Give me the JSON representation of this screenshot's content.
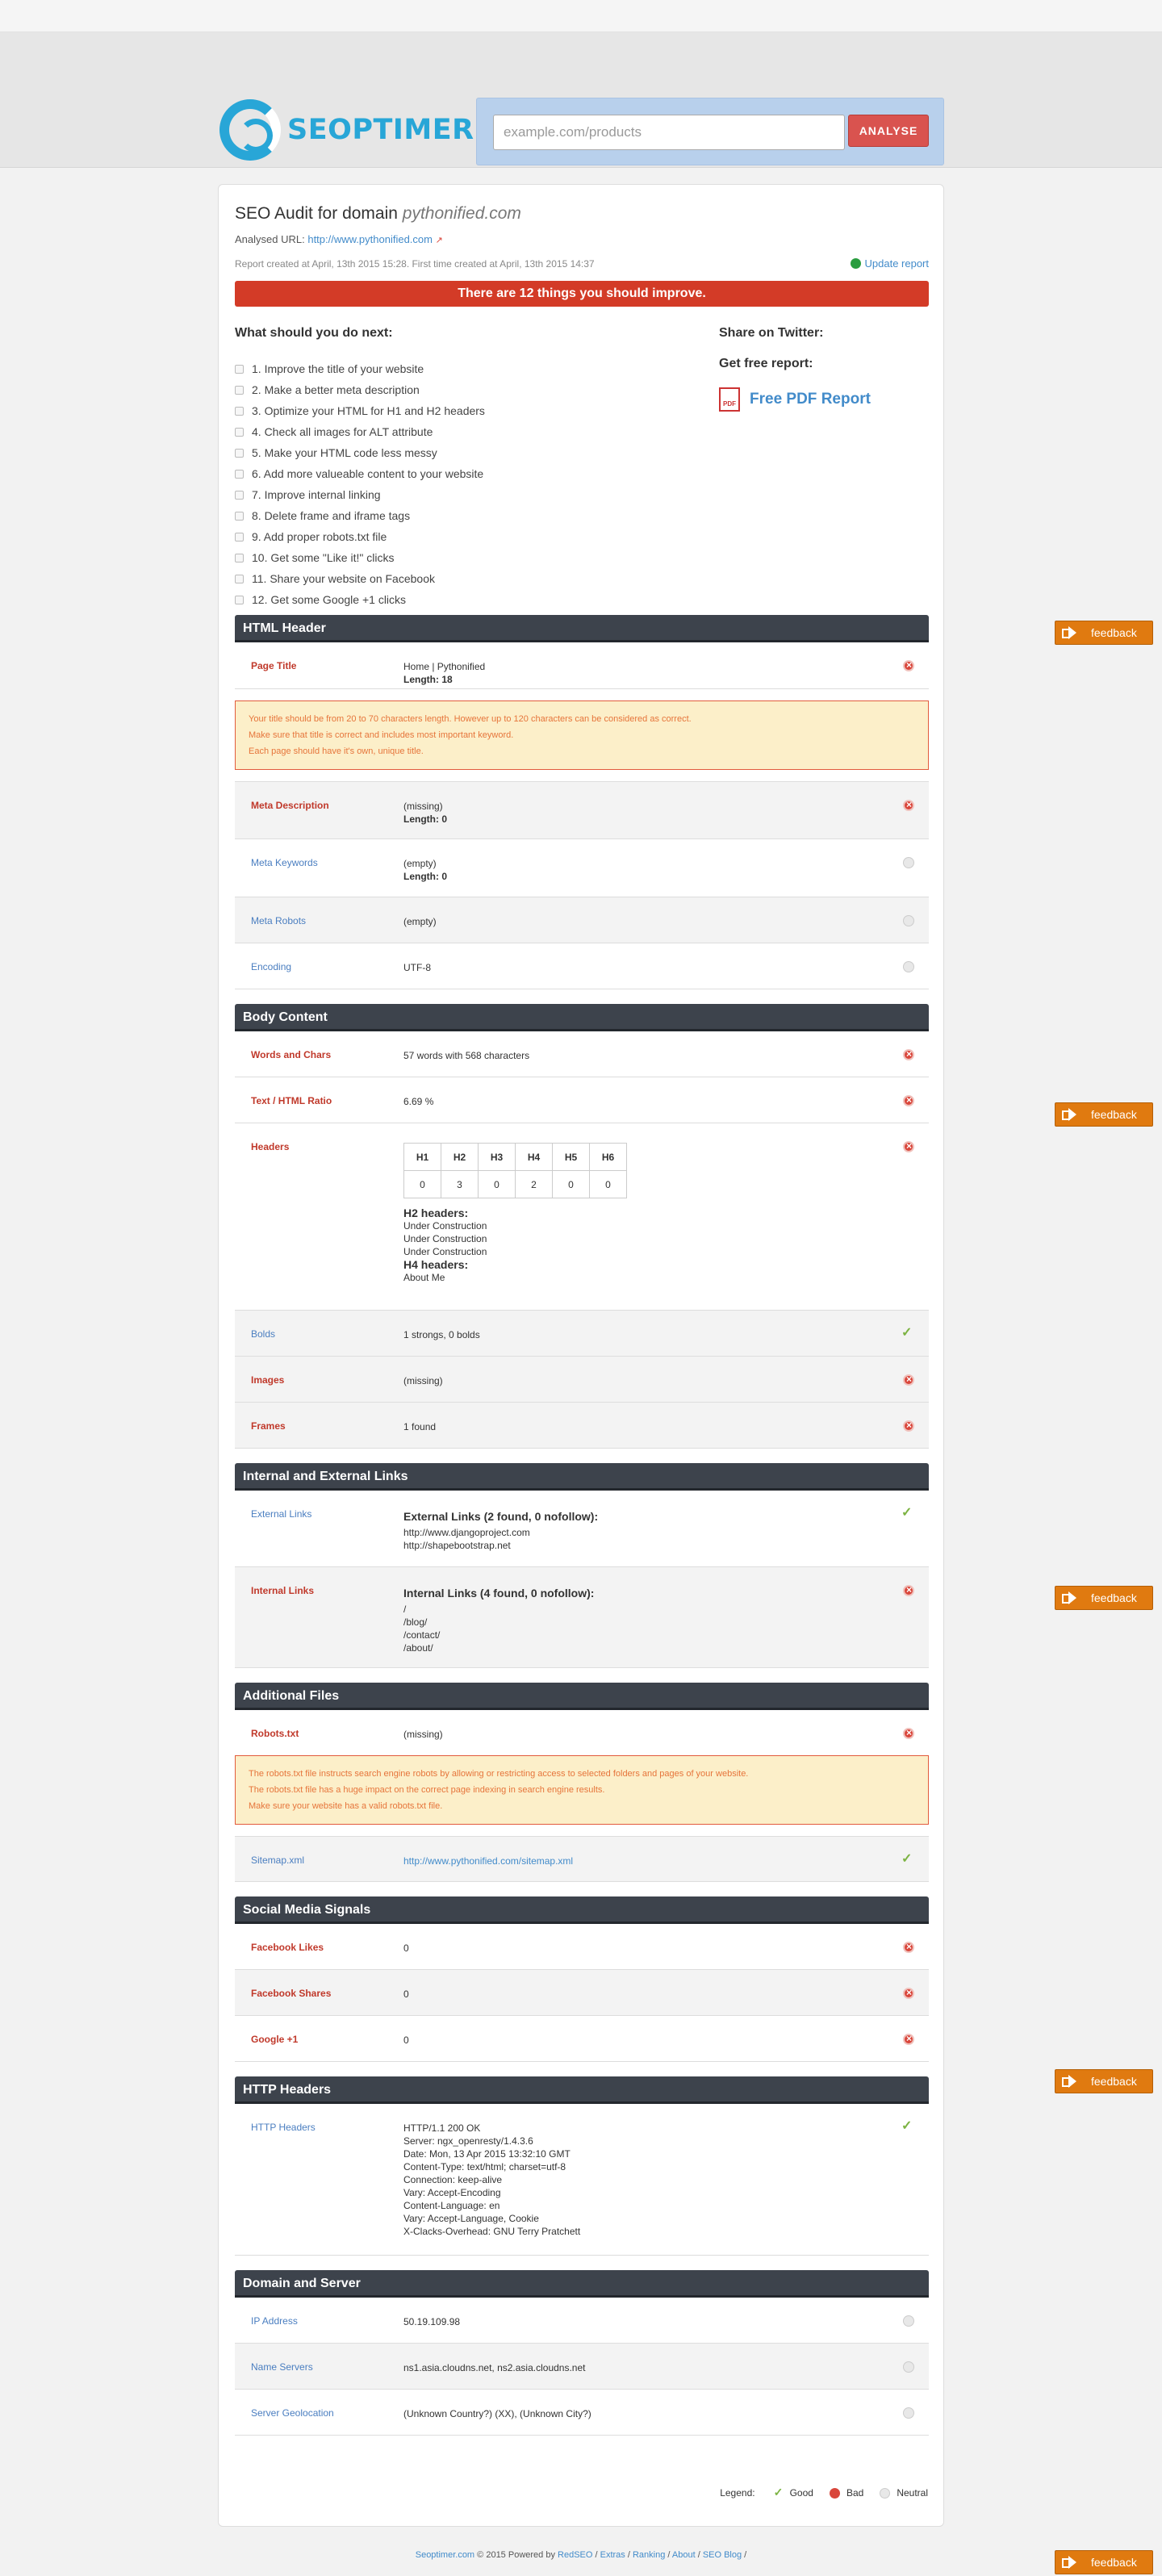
{
  "header": {
    "logo_text": "SEOPTIMER",
    "search_placeholder": "example.com/products",
    "analyse_label": "ANALYSE"
  },
  "report": {
    "title_prefix": "SEO Audit for domain",
    "domain": "pythonified.com",
    "analysed_label": "Analysed URL:",
    "analysed_url": "http://www.pythonified.com",
    "created_text": "Report created at April, 13th 2015 15:28. First time created at April, 13th 2015 14:37",
    "update_label": "Update report",
    "banner": "There are 12 things you should improve."
  },
  "todo": {
    "heading": "What should you do next:",
    "items": [
      "1. Improve the title of your website",
      "2. Make a better meta description",
      "3. Optimize your HTML for H1 and H2 headers",
      "4. Check all images for ALT attribute",
      "5. Make your HTML code less messy",
      "6. Add more valueable content to your website",
      "7. Improve internal linking",
      "8. Delete frame and iframe tags",
      "9. Add proper robots.txt file",
      "10. Get some \"Like it!\" clicks",
      "11. Share your website on Facebook",
      "12. Get some Google +1 clicks"
    ],
    "share_heading": "Share on Twitter:",
    "free_heading": "Get free report:",
    "pdf_label": "Free PDF Report",
    "pdf_icon_text": "PDF"
  },
  "html_header": {
    "title": "HTML Header",
    "page_title_label": "Page Title",
    "page_title_value": "Home | Pythonified",
    "page_title_length": "Length: 18",
    "warn": [
      "Your title should be from 20 to 70 characters length. However up to 120 characters can be considered as correct.",
      "Make sure that title is correct and includes most important keyword.",
      "Each page should have it's own, unique title."
    ],
    "meta_desc_label": "Meta Description",
    "meta_desc_value": "(missing)",
    "meta_desc_length": "Length: 0",
    "meta_kw_label": "Meta Keywords",
    "meta_kw_value": "(empty)",
    "meta_kw_length": "Length: 0",
    "meta_robots_label": "Meta Robots",
    "meta_robots_value": "(empty)",
    "encoding_label": "Encoding",
    "encoding_value": "UTF-8"
  },
  "body_content": {
    "title": "Body Content",
    "words_label": "Words and Chars",
    "words_value": "57 words with 568 characters",
    "ratio_label": "Text / HTML Ratio",
    "ratio_value": "6.69 %",
    "headers_label": "Headers",
    "header_cols": [
      "H1",
      "H2",
      "H3",
      "H4",
      "H5",
      "H6"
    ],
    "header_counts": [
      "0",
      "3",
      "0",
      "2",
      "0",
      "0"
    ],
    "h2_title": "H2 headers:",
    "h2_items": [
      "Under Construction",
      "Under Construction",
      "Under Construction"
    ],
    "h4_title": "H4 headers:",
    "h4_items": [
      "About Me"
    ],
    "bolds_label": "Bolds",
    "bolds_value": "1 strongs, 0 bolds",
    "images_label": "Images",
    "images_value": "(missing)",
    "frames_label": "Frames",
    "frames_value": "1 found"
  },
  "links": {
    "title": "Internal and External Links",
    "ext_label": "External Links",
    "ext_heading": "External Links (2 found, 0 nofollow):",
    "ext_items": [
      "http://www.djangoproject.com",
      "http://shapebootstrap.net"
    ],
    "int_label": "Internal Links",
    "int_heading": "Internal Links (4 found, 0 nofollow):",
    "int_items": [
      "/",
      "/blog/",
      "/contact/",
      "/about/"
    ]
  },
  "files": {
    "title": "Additional Files",
    "robots_label": "Robots.txt",
    "robots_value": "(missing)",
    "warn": [
      "The robots.txt file instructs search engine robots by allowing or restricting access to selected folders and pages of your website.",
      "The robots.txt file has a huge impact on the correct page indexing in search engine results.",
      "Make sure your website has a valid robots.txt file."
    ],
    "sitemap_label": "Sitemap.xml",
    "sitemap_value": "http://www.pythonified.com/sitemap.xml"
  },
  "social": {
    "title": "Social Media Signals",
    "fb_likes_label": "Facebook Likes",
    "fb_likes_value": "0",
    "fb_shares_label": "Facebook Shares",
    "fb_shares_value": "0",
    "gplus_label": "Google +1",
    "gplus_value": "0"
  },
  "http": {
    "title": "HTTP Headers",
    "label": "HTTP Headers",
    "lines": [
      "HTTP/1.1 200 OK",
      "Server: ngx_openresty/1.4.3.6",
      "Date: Mon, 13 Apr 2015 13:32:10 GMT",
      "Content-Type: text/html; charset=utf-8",
      "Connection: keep-alive",
      "Vary: Accept-Encoding",
      "Content-Language: en",
      "Vary: Accept-Language, Cookie",
      "X-Clacks-Overhead: GNU Terry Pratchett"
    ]
  },
  "domain": {
    "title": "Domain and Server",
    "ip_label": "IP Address",
    "ip_value": "50.19.109.98",
    "ns_label": "Name Servers",
    "ns_value": "ns1.asia.cloudns.net, ns2.asia.cloudns.net",
    "geo_label": "Server Geolocation",
    "geo_value": "(Unknown Country?) (XX), (Unknown City?)"
  },
  "legend": {
    "label": "Legend:",
    "good": "Good",
    "bad": "Bad",
    "neutral": "Neutral"
  },
  "footer": {
    "site": "Seoptimer.com",
    "text": "© 2015 Powered by",
    "powered": "RedSEO",
    "links": [
      "Extras",
      "Ranking",
      "About",
      "SEO Blog"
    ]
  },
  "feedback_label": "feedback",
  "colors": {
    "brand_blue": "#28a6d7",
    "bad_red": "#d33b27",
    "section_dark": "#3d434c",
    "feedback_orange": "#e07a10"
  }
}
